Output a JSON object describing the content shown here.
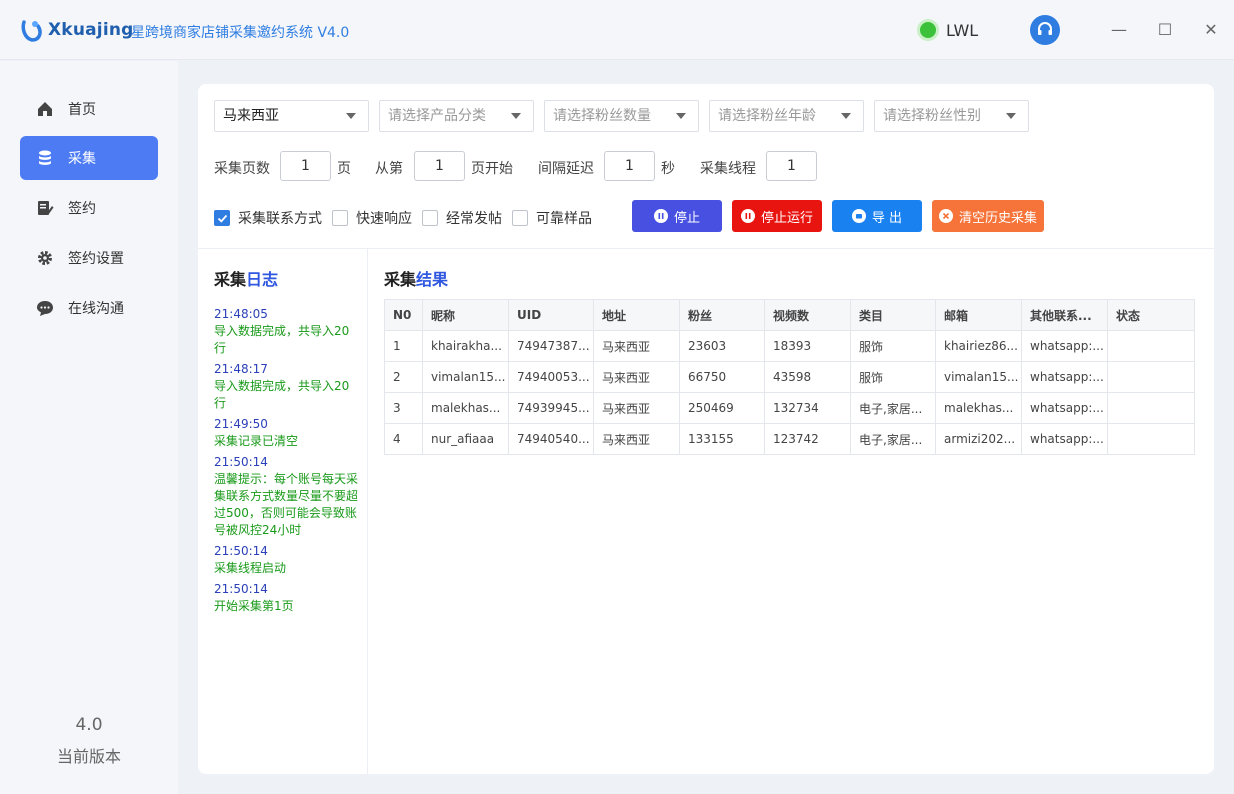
{
  "app": {
    "brand": "Xkuajing",
    "title": "星跨境商家店铺采集邀约系统 V4.0",
    "user": "LWL",
    "status_color": "#3cc13b",
    "accent": "#4c7bf3"
  },
  "window_controls": {
    "minimize": "—",
    "maximize": "☐",
    "close": "✕"
  },
  "sidebar": {
    "items": [
      {
        "label": "首页",
        "icon": "home-icon"
      },
      {
        "label": "采集",
        "icon": "database-icon",
        "active": true
      },
      {
        "label": "签约",
        "icon": "edit-document-icon"
      },
      {
        "label": "签约设置",
        "icon": "gear-icon"
      },
      {
        "label": "在线沟通",
        "icon": "chat-icon"
      }
    ],
    "version_number": "4.0",
    "version_label": "当前版本"
  },
  "filters": {
    "country": "马来西亚",
    "category_placeholder": "请选择产品分类",
    "fans_count_placeholder": "请选择粉丝数量",
    "fans_age_placeholder": "请选择粉丝年龄",
    "fans_gender_placeholder": "请选择粉丝性别"
  },
  "params": {
    "pages_label": "采集页数",
    "pages_value": "1",
    "pages_unit": "页",
    "from_label": "从第",
    "from_value": "1",
    "from_unit": "页开始",
    "delay_label": "间隔延迟",
    "delay_value": "1",
    "delay_unit": "秒",
    "threads_label": "采集线程",
    "threads_value": "1"
  },
  "options": [
    {
      "label": "采集联系方式",
      "checked": true
    },
    {
      "label": "快速响应",
      "checked": false
    },
    {
      "label": "经常发帖",
      "checked": false
    },
    {
      "label": "可靠样品",
      "checked": false
    }
  ],
  "actions": {
    "stop": "停止",
    "stop_run": "停止运行",
    "export": "导 出",
    "clear_history": "清空历史采集",
    "colors": {
      "stop": "#4750e0",
      "stop_run": "#e8140f",
      "export": "#1a82f0",
      "clear": "#f6743a"
    }
  },
  "log": {
    "title_a": "采集",
    "title_b": "日志",
    "entries": [
      {
        "time": "21:48:05",
        "msg": "导入数据完成，共导入20行"
      },
      {
        "time": "21:48:17",
        "msg": "导入数据完成，共导入20行"
      },
      {
        "time": "21:49:50",
        "msg": "采集记录已清空"
      },
      {
        "time": "21:50:14",
        "msg": "温馨提示：每个账号每天采集联系方式数量尽量不要超过500，否则可能会导致账号被风控24小时"
      },
      {
        "time": "21:50:14",
        "msg": "采集线程启动"
      },
      {
        "time": "21:50:14",
        "msg": "开始采集第1页"
      }
    ]
  },
  "results": {
    "title_a": "采集",
    "title_b": "结果",
    "columns": [
      "N0",
      "昵称",
      "UID",
      "地址",
      "粉丝",
      "视频数",
      "类目",
      "邮箱",
      "其他联系...",
      "状态"
    ],
    "rows": [
      [
        "1",
        "khairakha...",
        "74947387...",
        "马来西亚",
        "23603",
        "18393",
        "服饰",
        "khairiez86...",
        "whatsapp:...",
        ""
      ],
      [
        "2",
        "vimalan15...",
        "74940053...",
        "马来西亚",
        "66750",
        "43598",
        "服饰",
        "vimalan15...",
        "whatsapp:...",
        ""
      ],
      [
        "3",
        "malekhas...",
        "74939945...",
        "马来西亚",
        "250469",
        "132734",
        "电子,家居...",
        "malekhas...",
        "whatsapp:...",
        ""
      ],
      [
        "4",
        "nur_afiaaa",
        "74940540...",
        "马来西亚",
        "133155",
        "123742",
        "电子,家居...",
        "armizi202...",
        "whatsapp:...",
        ""
      ]
    ]
  }
}
